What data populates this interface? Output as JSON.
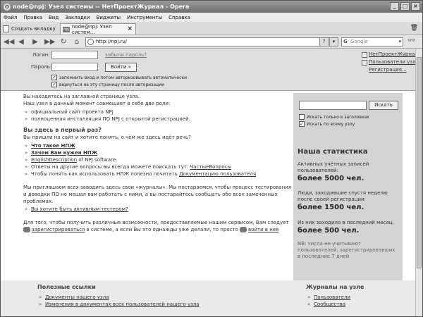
{
  "window": {
    "title": "node@npj: Узел системы -- НетПроектЖурнал - Opera",
    "icon": "opera-icon"
  },
  "menu": [
    "Файл",
    "Правка",
    "Вид",
    "Закладки",
    "Виджеты",
    "Инструменты",
    "Справка"
  ],
  "tabs": {
    "new_tab_label": "Создать вкладку",
    "active_tab_label": "node@npj: Узел систем..."
  },
  "nav": {
    "address": "http://npj.ru/",
    "search_placeholder": "Google"
  },
  "login": {
    "login_label": "Логин:",
    "password_label": "Пароль:",
    "forgot_link": "забыли пароль?",
    "enter_button": "Войти »",
    "remember_label": "запомнить вход и потом авторизовывать автоматически",
    "return_label": "вернуться на эту страницу после авторизации"
  },
  "toplinks": [
    "НетПроектЖурнал",
    "Пользователи узла",
    "Регистрация..."
  ],
  "main": {
    "intro1": "Вы находитесь на заглавной странице узла.",
    "intro2": "Наш узел в данный момент совмещает в себе две роли:",
    "roles": [
      "официальный сайт проекта NPJ",
      "полноценная инсталляция ПО NPJ с открытой регистрацией."
    ],
    "first_time_heading": "Вы здесь в первый раз?",
    "first_time_text": "Вы пришли на сайт и хотите понять, о чём же здесь идёт речь?",
    "link_what": "Что такое НПЖ",
    "link_why": "Зачем Вам нужен НПЖ",
    "english_link": "EnglishDescription",
    "english_rest": " of NPJ software.",
    "faq_text": "Ответы на другие вопросы вы всегда можете поискать тут: ",
    "faq_link": "ЧастыеВопросы",
    "doc_text": "Чтобы понять как использовать НПЖ полезно почитать ",
    "doc_link": "Документацию пользователя",
    "invite1": "Мы приглашаем всех заводить здесь свои «журналы». Мы постараемся, чтобы процесс тестирования",
    "invite2": "и доводки ПО не мешал вам работать с ними, а вы постарайтесь сообщать обо всех замеченных проблемах.",
    "active_tester_link": "Вы хотите быть активным тестером?",
    "register1": "Для того, чтобы получить различные возможности, предоставляемые нашим сервисом, Вам следует",
    "register_link": "зарегистрироваться",
    "register_mid": " в системе, а если Вы это однажды уже делали, то просто ",
    "login_link": "войти в неё"
  },
  "sidebar": {
    "search_button": "Искать",
    "only_titles": "Искать только в заголовках",
    "whole_node": "Искать по всему узлу",
    "stats_title": "Наша статистика",
    "stats": [
      {
        "label": "Активных учётных записей пользователей:",
        "value": "более 5000 чел."
      },
      {
        "label": "Люди, заходившие спустя неделю после своей регистрации:",
        "value": "более 1500 чел."
      },
      {
        "label": "Из них заходило в последний месяц:",
        "value": "более 500 чел."
      }
    ],
    "note": "NB: числа не учитывают пользователей, зарегистрировавших в последние 7 дней"
  },
  "bottom": {
    "useful_title": "Полезные ссылки",
    "useful_links": [
      "Документы нашего узла",
      "Изменения в документах всех пользователей нашего узла"
    ],
    "journals_title": "Журналы на узле",
    "journal_links": [
      "Пользователи",
      "Сообщества"
    ]
  }
}
